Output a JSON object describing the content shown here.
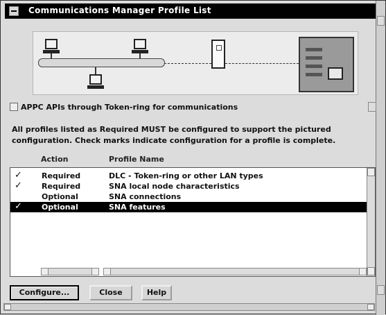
{
  "window": {
    "title": "Communications Manager Profile List"
  },
  "diagram": {
    "caption": ""
  },
  "option": {
    "label": "APPC APIs through Token-ring for communications"
  },
  "info_text": "All profiles listed as Required MUST be configured to support the pictured configuration. Check marks indicate configuration for a profile is complete.",
  "table": {
    "headers": {
      "action": "Action",
      "profile_name": "Profile Name"
    },
    "rows": [
      {
        "check": "✓",
        "action": "Required",
        "name": "DLC - Token-ring or other LAN types",
        "selected": false
      },
      {
        "check": "✓",
        "action": "Required",
        "name": "SNA local node characteristics",
        "selected": false
      },
      {
        "check": "",
        "action": "Optional",
        "name": "SNA connections",
        "selected": false
      },
      {
        "check": "✓",
        "action": "Optional",
        "name": "SNA features",
        "selected": true
      }
    ]
  },
  "buttons": {
    "configure": "Configure...",
    "close": "Close",
    "help": "Help"
  },
  "icons": {
    "system_menu": "system-menu-icon",
    "check": "check-icon"
  }
}
